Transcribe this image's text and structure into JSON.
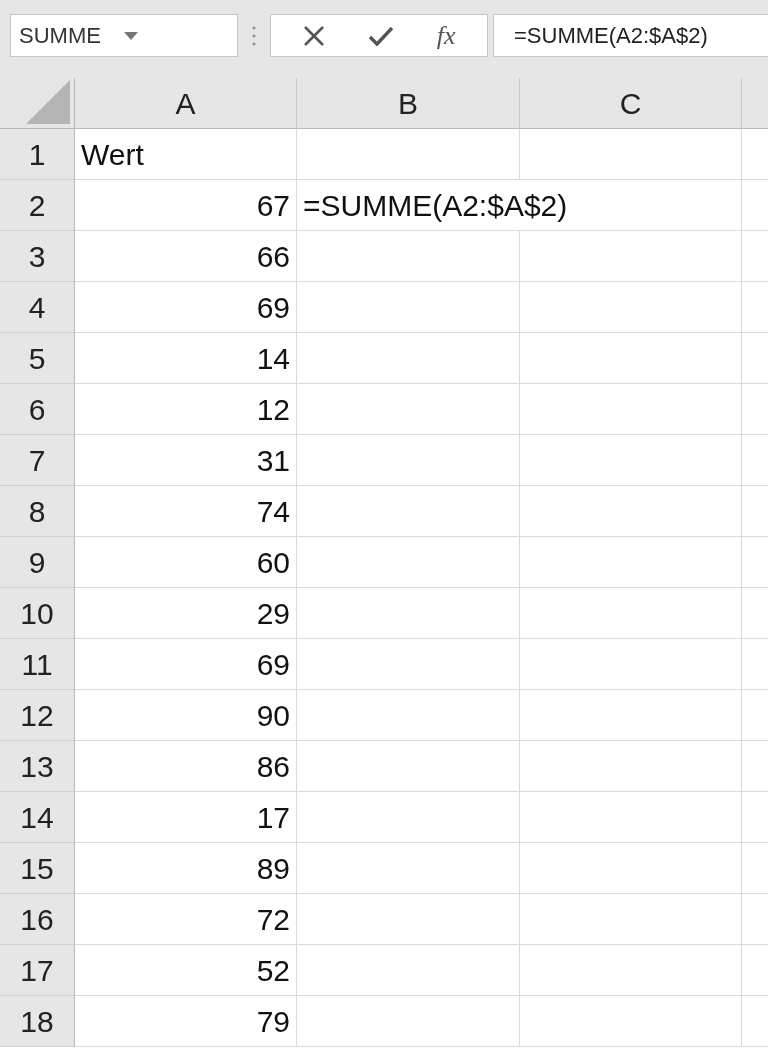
{
  "name_box": {
    "value": "SUMME"
  },
  "formula_bar": {
    "fx": "fx",
    "formula": "=SUMME(A2:$A$2)"
  },
  "columns": [
    "A",
    "B",
    "C"
  ],
  "rows": [
    {
      "number": "1",
      "a": {
        "text": "Wert",
        "kind": "text"
      }
    },
    {
      "number": "2",
      "a": {
        "text": "67",
        "kind": "number"
      },
      "b": "=SUMME(A2:$A$2)"
    },
    {
      "number": "3",
      "a": {
        "text": "66",
        "kind": "number"
      }
    },
    {
      "number": "4",
      "a": {
        "text": "69",
        "kind": "number"
      }
    },
    {
      "number": "5",
      "a": {
        "text": "14",
        "kind": "number"
      }
    },
    {
      "number": "6",
      "a": {
        "text": "12",
        "kind": "number"
      }
    },
    {
      "number": "7",
      "a": {
        "text": "31",
        "kind": "number"
      }
    },
    {
      "number": "8",
      "a": {
        "text": "74",
        "kind": "number"
      }
    },
    {
      "number": "9",
      "a": {
        "text": "60",
        "kind": "number"
      }
    },
    {
      "number": "10",
      "a": {
        "text": "29",
        "kind": "number"
      }
    },
    {
      "number": "11",
      "a": {
        "text": "69",
        "kind": "number"
      }
    },
    {
      "number": "12",
      "a": {
        "text": "90",
        "kind": "number"
      }
    },
    {
      "number": "13",
      "a": {
        "text": "86",
        "kind": "number"
      }
    },
    {
      "number": "14",
      "a": {
        "text": "17",
        "kind": "number"
      }
    },
    {
      "number": "15",
      "a": {
        "text": "89",
        "kind": "number"
      }
    },
    {
      "number": "16",
      "a": {
        "text": "72",
        "kind": "number"
      }
    },
    {
      "number": "17",
      "a": {
        "text": "52",
        "kind": "number"
      }
    },
    {
      "number": "18",
      "a": {
        "text": "79",
        "kind": "number"
      }
    }
  ]
}
